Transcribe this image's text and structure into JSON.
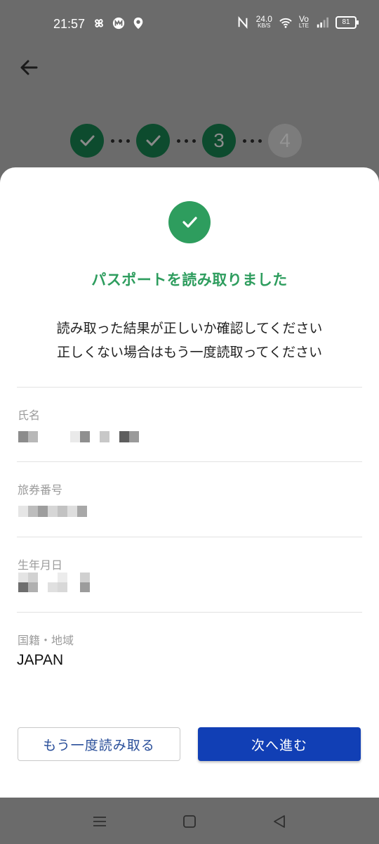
{
  "status_bar": {
    "time": "21:57",
    "net_speed_value": "24.0",
    "net_speed_unit": "KB/S",
    "volte_top": "Vo",
    "volte_bottom": "LTE",
    "battery": "81"
  },
  "stepper": {
    "steps": [
      {
        "label": "",
        "state": "done"
      },
      {
        "label": "",
        "state": "done"
      },
      {
        "label": "3",
        "state": "active"
      },
      {
        "label": "4",
        "state": "pending"
      }
    ]
  },
  "sheet": {
    "title": "パスポートを読み取りました",
    "description_line1": "読み取った結果が正しいか確認してください",
    "description_line2": "正しくない場合はもう一度読取ってください",
    "fields": {
      "name": {
        "label": "氏名"
      },
      "passport_number": {
        "label": "旅券番号"
      },
      "birth_date": {
        "label": "生年月日"
      },
      "nationality": {
        "label": "国籍・地域",
        "value": "JAPAN"
      }
    },
    "retry_button": "もう一度読み取る",
    "next_button": "次へ進む"
  },
  "colors": {
    "accent_green": "#2e9d5e",
    "step_green": "#0d4b2e",
    "primary_blue": "#113fb5",
    "secondary_text_blue": "#2a4f9a",
    "scrim": "#6b6b6b"
  },
  "icons": {
    "back": "arrow-left-icon",
    "success": "check-circle-icon",
    "nav_menu": "menu-icon",
    "nav_home": "square-home-icon",
    "nav_back": "triangle-back-icon"
  }
}
